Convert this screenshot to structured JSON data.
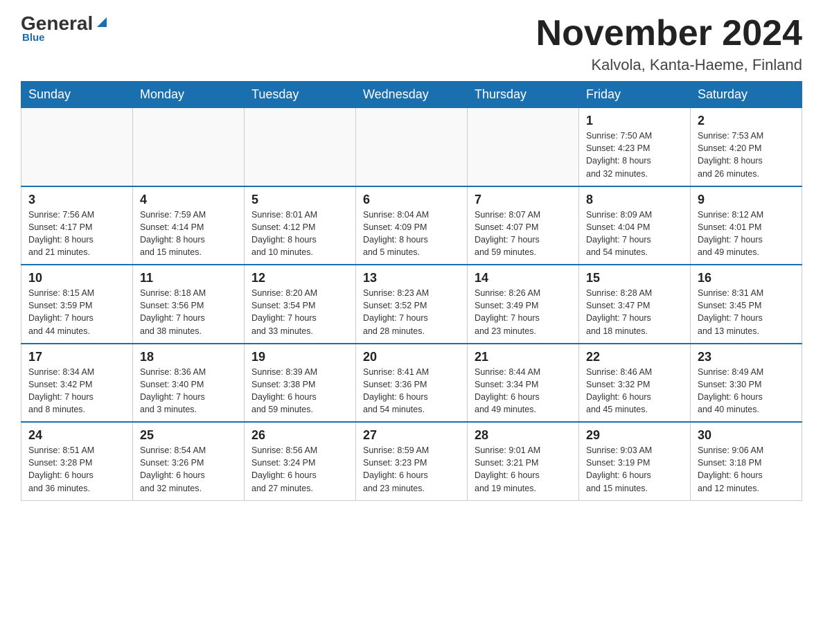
{
  "logo": {
    "text1": "General",
    "text2": "Blue"
  },
  "calendar": {
    "title": "November 2024",
    "subtitle": "Kalvola, Kanta-Haeme, Finland"
  },
  "weekdays": [
    "Sunday",
    "Monday",
    "Tuesday",
    "Wednesday",
    "Thursday",
    "Friday",
    "Saturday"
  ],
  "weeks": [
    [
      {
        "day": "",
        "info": ""
      },
      {
        "day": "",
        "info": ""
      },
      {
        "day": "",
        "info": ""
      },
      {
        "day": "",
        "info": ""
      },
      {
        "day": "",
        "info": ""
      },
      {
        "day": "1",
        "info": "Sunrise: 7:50 AM\nSunset: 4:23 PM\nDaylight: 8 hours\nand 32 minutes."
      },
      {
        "day": "2",
        "info": "Sunrise: 7:53 AM\nSunset: 4:20 PM\nDaylight: 8 hours\nand 26 minutes."
      }
    ],
    [
      {
        "day": "3",
        "info": "Sunrise: 7:56 AM\nSunset: 4:17 PM\nDaylight: 8 hours\nand 21 minutes."
      },
      {
        "day": "4",
        "info": "Sunrise: 7:59 AM\nSunset: 4:14 PM\nDaylight: 8 hours\nand 15 minutes."
      },
      {
        "day": "5",
        "info": "Sunrise: 8:01 AM\nSunset: 4:12 PM\nDaylight: 8 hours\nand 10 minutes."
      },
      {
        "day": "6",
        "info": "Sunrise: 8:04 AM\nSunset: 4:09 PM\nDaylight: 8 hours\nand 5 minutes."
      },
      {
        "day": "7",
        "info": "Sunrise: 8:07 AM\nSunset: 4:07 PM\nDaylight: 7 hours\nand 59 minutes."
      },
      {
        "day": "8",
        "info": "Sunrise: 8:09 AM\nSunset: 4:04 PM\nDaylight: 7 hours\nand 54 minutes."
      },
      {
        "day": "9",
        "info": "Sunrise: 8:12 AM\nSunset: 4:01 PM\nDaylight: 7 hours\nand 49 minutes."
      }
    ],
    [
      {
        "day": "10",
        "info": "Sunrise: 8:15 AM\nSunset: 3:59 PM\nDaylight: 7 hours\nand 44 minutes."
      },
      {
        "day": "11",
        "info": "Sunrise: 8:18 AM\nSunset: 3:56 PM\nDaylight: 7 hours\nand 38 minutes."
      },
      {
        "day": "12",
        "info": "Sunrise: 8:20 AM\nSunset: 3:54 PM\nDaylight: 7 hours\nand 33 minutes."
      },
      {
        "day": "13",
        "info": "Sunrise: 8:23 AM\nSunset: 3:52 PM\nDaylight: 7 hours\nand 28 minutes."
      },
      {
        "day": "14",
        "info": "Sunrise: 8:26 AM\nSunset: 3:49 PM\nDaylight: 7 hours\nand 23 minutes."
      },
      {
        "day": "15",
        "info": "Sunrise: 8:28 AM\nSunset: 3:47 PM\nDaylight: 7 hours\nand 18 minutes."
      },
      {
        "day": "16",
        "info": "Sunrise: 8:31 AM\nSunset: 3:45 PM\nDaylight: 7 hours\nand 13 minutes."
      }
    ],
    [
      {
        "day": "17",
        "info": "Sunrise: 8:34 AM\nSunset: 3:42 PM\nDaylight: 7 hours\nand 8 minutes."
      },
      {
        "day": "18",
        "info": "Sunrise: 8:36 AM\nSunset: 3:40 PM\nDaylight: 7 hours\nand 3 minutes."
      },
      {
        "day": "19",
        "info": "Sunrise: 8:39 AM\nSunset: 3:38 PM\nDaylight: 6 hours\nand 59 minutes."
      },
      {
        "day": "20",
        "info": "Sunrise: 8:41 AM\nSunset: 3:36 PM\nDaylight: 6 hours\nand 54 minutes."
      },
      {
        "day": "21",
        "info": "Sunrise: 8:44 AM\nSunset: 3:34 PM\nDaylight: 6 hours\nand 49 minutes."
      },
      {
        "day": "22",
        "info": "Sunrise: 8:46 AM\nSunset: 3:32 PM\nDaylight: 6 hours\nand 45 minutes."
      },
      {
        "day": "23",
        "info": "Sunrise: 8:49 AM\nSunset: 3:30 PM\nDaylight: 6 hours\nand 40 minutes."
      }
    ],
    [
      {
        "day": "24",
        "info": "Sunrise: 8:51 AM\nSunset: 3:28 PM\nDaylight: 6 hours\nand 36 minutes."
      },
      {
        "day": "25",
        "info": "Sunrise: 8:54 AM\nSunset: 3:26 PM\nDaylight: 6 hours\nand 32 minutes."
      },
      {
        "day": "26",
        "info": "Sunrise: 8:56 AM\nSunset: 3:24 PM\nDaylight: 6 hours\nand 27 minutes."
      },
      {
        "day": "27",
        "info": "Sunrise: 8:59 AM\nSunset: 3:23 PM\nDaylight: 6 hours\nand 23 minutes."
      },
      {
        "day": "28",
        "info": "Sunrise: 9:01 AM\nSunset: 3:21 PM\nDaylight: 6 hours\nand 19 minutes."
      },
      {
        "day": "29",
        "info": "Sunrise: 9:03 AM\nSunset: 3:19 PM\nDaylight: 6 hours\nand 15 minutes."
      },
      {
        "day": "30",
        "info": "Sunrise: 9:06 AM\nSunset: 3:18 PM\nDaylight: 6 hours\nand 12 minutes."
      }
    ]
  ]
}
